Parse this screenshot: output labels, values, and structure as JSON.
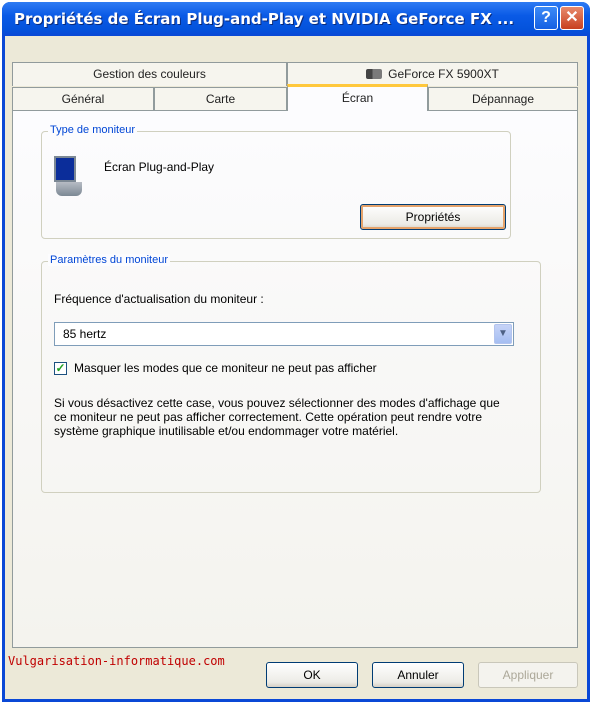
{
  "window": {
    "title": "Propriétés de Écran Plug-and-Play et NVIDIA GeForce FX ...",
    "help_glyph": "?",
    "close_glyph": "✕"
  },
  "tabs": {
    "row_back": [
      "Gestion des couleurs",
      "GeForce FX 5900XT"
    ],
    "row_front": [
      "Général",
      "Carte",
      "Écran",
      "Dépannage"
    ],
    "active": "Écran"
  },
  "monitor_type": {
    "legend": "Type de moniteur",
    "monitor_name": "Écran Plug-and-Play",
    "properties_button": "Propriétés"
  },
  "monitor_settings": {
    "legend": "Paramètres du moniteur",
    "refresh_label": "Fréquence d'actualisation du moniteur :",
    "refresh_value": "85 hertz",
    "hide_modes_checked": true,
    "hide_modes_label": "Masquer les modes que ce moniteur ne peut pas afficher",
    "warning_text": "Si vous désactivez cette case, vous pouvez sélectionner des modes d'affichage que ce moniteur ne peut pas afficher correctement. Cette opération peut rendre votre système graphique inutilisable et/ou endommager votre matériel."
  },
  "footer": {
    "ok": "OK",
    "cancel": "Annuler",
    "apply": "Appliquer",
    "watermark": "Vulgarisation-informatique.com"
  },
  "colors": {
    "title_bar": "#0a5ae6",
    "legend_text": "#0046d5",
    "active_tab_accent": "#ffc83c",
    "watermark": "#c00000"
  },
  "icons": [
    "help-icon",
    "close-icon",
    "monitor-icon",
    "graphics-card-icon",
    "dropdown-arrow-icon",
    "checkmark-icon"
  ]
}
